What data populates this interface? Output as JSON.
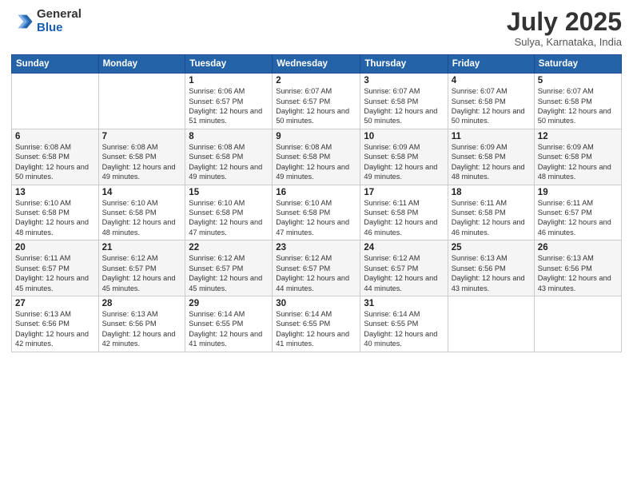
{
  "logo": {
    "general": "General",
    "blue": "Blue"
  },
  "header": {
    "month": "July 2025",
    "location": "Sulya, Karnataka, India"
  },
  "days_of_week": [
    "Sunday",
    "Monday",
    "Tuesday",
    "Wednesday",
    "Thursday",
    "Friday",
    "Saturday"
  ],
  "weeks": [
    [
      {
        "day": "",
        "info": ""
      },
      {
        "day": "",
        "info": ""
      },
      {
        "day": "1",
        "info": "Sunrise: 6:06 AM\nSunset: 6:57 PM\nDaylight: 12 hours and 51 minutes."
      },
      {
        "day": "2",
        "info": "Sunrise: 6:07 AM\nSunset: 6:57 PM\nDaylight: 12 hours and 50 minutes."
      },
      {
        "day": "3",
        "info": "Sunrise: 6:07 AM\nSunset: 6:58 PM\nDaylight: 12 hours and 50 minutes."
      },
      {
        "day": "4",
        "info": "Sunrise: 6:07 AM\nSunset: 6:58 PM\nDaylight: 12 hours and 50 minutes."
      },
      {
        "day": "5",
        "info": "Sunrise: 6:07 AM\nSunset: 6:58 PM\nDaylight: 12 hours and 50 minutes."
      }
    ],
    [
      {
        "day": "6",
        "info": "Sunrise: 6:08 AM\nSunset: 6:58 PM\nDaylight: 12 hours and 50 minutes."
      },
      {
        "day": "7",
        "info": "Sunrise: 6:08 AM\nSunset: 6:58 PM\nDaylight: 12 hours and 49 minutes."
      },
      {
        "day": "8",
        "info": "Sunrise: 6:08 AM\nSunset: 6:58 PM\nDaylight: 12 hours and 49 minutes."
      },
      {
        "day": "9",
        "info": "Sunrise: 6:08 AM\nSunset: 6:58 PM\nDaylight: 12 hours and 49 minutes."
      },
      {
        "day": "10",
        "info": "Sunrise: 6:09 AM\nSunset: 6:58 PM\nDaylight: 12 hours and 49 minutes."
      },
      {
        "day": "11",
        "info": "Sunrise: 6:09 AM\nSunset: 6:58 PM\nDaylight: 12 hours and 48 minutes."
      },
      {
        "day": "12",
        "info": "Sunrise: 6:09 AM\nSunset: 6:58 PM\nDaylight: 12 hours and 48 minutes."
      }
    ],
    [
      {
        "day": "13",
        "info": "Sunrise: 6:10 AM\nSunset: 6:58 PM\nDaylight: 12 hours and 48 minutes."
      },
      {
        "day": "14",
        "info": "Sunrise: 6:10 AM\nSunset: 6:58 PM\nDaylight: 12 hours and 48 minutes."
      },
      {
        "day": "15",
        "info": "Sunrise: 6:10 AM\nSunset: 6:58 PM\nDaylight: 12 hours and 47 minutes."
      },
      {
        "day": "16",
        "info": "Sunrise: 6:10 AM\nSunset: 6:58 PM\nDaylight: 12 hours and 47 minutes."
      },
      {
        "day": "17",
        "info": "Sunrise: 6:11 AM\nSunset: 6:58 PM\nDaylight: 12 hours and 46 minutes."
      },
      {
        "day": "18",
        "info": "Sunrise: 6:11 AM\nSunset: 6:58 PM\nDaylight: 12 hours and 46 minutes."
      },
      {
        "day": "19",
        "info": "Sunrise: 6:11 AM\nSunset: 6:57 PM\nDaylight: 12 hours and 46 minutes."
      }
    ],
    [
      {
        "day": "20",
        "info": "Sunrise: 6:11 AM\nSunset: 6:57 PM\nDaylight: 12 hours and 45 minutes."
      },
      {
        "day": "21",
        "info": "Sunrise: 6:12 AM\nSunset: 6:57 PM\nDaylight: 12 hours and 45 minutes."
      },
      {
        "day": "22",
        "info": "Sunrise: 6:12 AM\nSunset: 6:57 PM\nDaylight: 12 hours and 45 minutes."
      },
      {
        "day": "23",
        "info": "Sunrise: 6:12 AM\nSunset: 6:57 PM\nDaylight: 12 hours and 44 minutes."
      },
      {
        "day": "24",
        "info": "Sunrise: 6:12 AM\nSunset: 6:57 PM\nDaylight: 12 hours and 44 minutes."
      },
      {
        "day": "25",
        "info": "Sunrise: 6:13 AM\nSunset: 6:56 PM\nDaylight: 12 hours and 43 minutes."
      },
      {
        "day": "26",
        "info": "Sunrise: 6:13 AM\nSunset: 6:56 PM\nDaylight: 12 hours and 43 minutes."
      }
    ],
    [
      {
        "day": "27",
        "info": "Sunrise: 6:13 AM\nSunset: 6:56 PM\nDaylight: 12 hours and 42 minutes."
      },
      {
        "day": "28",
        "info": "Sunrise: 6:13 AM\nSunset: 6:56 PM\nDaylight: 12 hours and 42 minutes."
      },
      {
        "day": "29",
        "info": "Sunrise: 6:14 AM\nSunset: 6:55 PM\nDaylight: 12 hours and 41 minutes."
      },
      {
        "day": "30",
        "info": "Sunrise: 6:14 AM\nSunset: 6:55 PM\nDaylight: 12 hours and 41 minutes."
      },
      {
        "day": "31",
        "info": "Sunrise: 6:14 AM\nSunset: 6:55 PM\nDaylight: 12 hours and 40 minutes."
      },
      {
        "day": "",
        "info": ""
      },
      {
        "day": "",
        "info": ""
      }
    ]
  ]
}
